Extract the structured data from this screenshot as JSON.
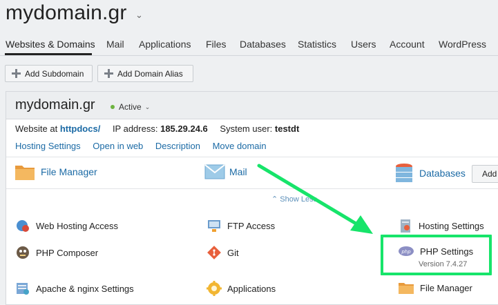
{
  "header": {
    "domain": "mydomain.gr",
    "caret": "⌄"
  },
  "tabs": [
    {
      "label": "Websites & Domains",
      "active": true
    },
    {
      "label": "Mail"
    },
    {
      "label": "Applications"
    },
    {
      "label": "Files"
    },
    {
      "label": "Databases"
    },
    {
      "label": "Statistics"
    },
    {
      "label": "Users"
    },
    {
      "label": "Account"
    },
    {
      "label": "WordPress"
    }
  ],
  "toolbar": {
    "add_subdomain": "Add Subdomain",
    "add_alias": "Add Domain Alias"
  },
  "domain_panel": {
    "title": "mydomain.gr",
    "status": "Active",
    "status_caret": "⌄",
    "info": {
      "website_at_label": "Website at",
      "website_at_value": "httpdocs/",
      "ip_label": "IP address:",
      "ip_value": "185.29.24.6",
      "user_label": "System user:",
      "user_value": "testdt"
    },
    "quick_links": [
      "Hosting Settings",
      "Open in web",
      "Description",
      "Move domain"
    ],
    "main_items": {
      "file_manager": "File Manager",
      "mail": "Mail",
      "databases": "Databases",
      "add": "Add"
    },
    "show_less": "⌃ Show Less",
    "tools": {
      "web_hosting_access": "Web Hosting Access",
      "ftp_access": "FTP Access",
      "hosting_settings": "Hosting Settings",
      "php_composer": "PHP Composer",
      "git": "Git",
      "php_settings": "PHP Settings",
      "php_version": "Version 7.4.27",
      "apache_nginx": "Apache & nginx Settings",
      "applications": "Applications",
      "file_manager": "File Manager"
    }
  },
  "colors": {
    "link": "#1b6aa5",
    "highlight": "#17e46a",
    "active": "#6db33f"
  }
}
